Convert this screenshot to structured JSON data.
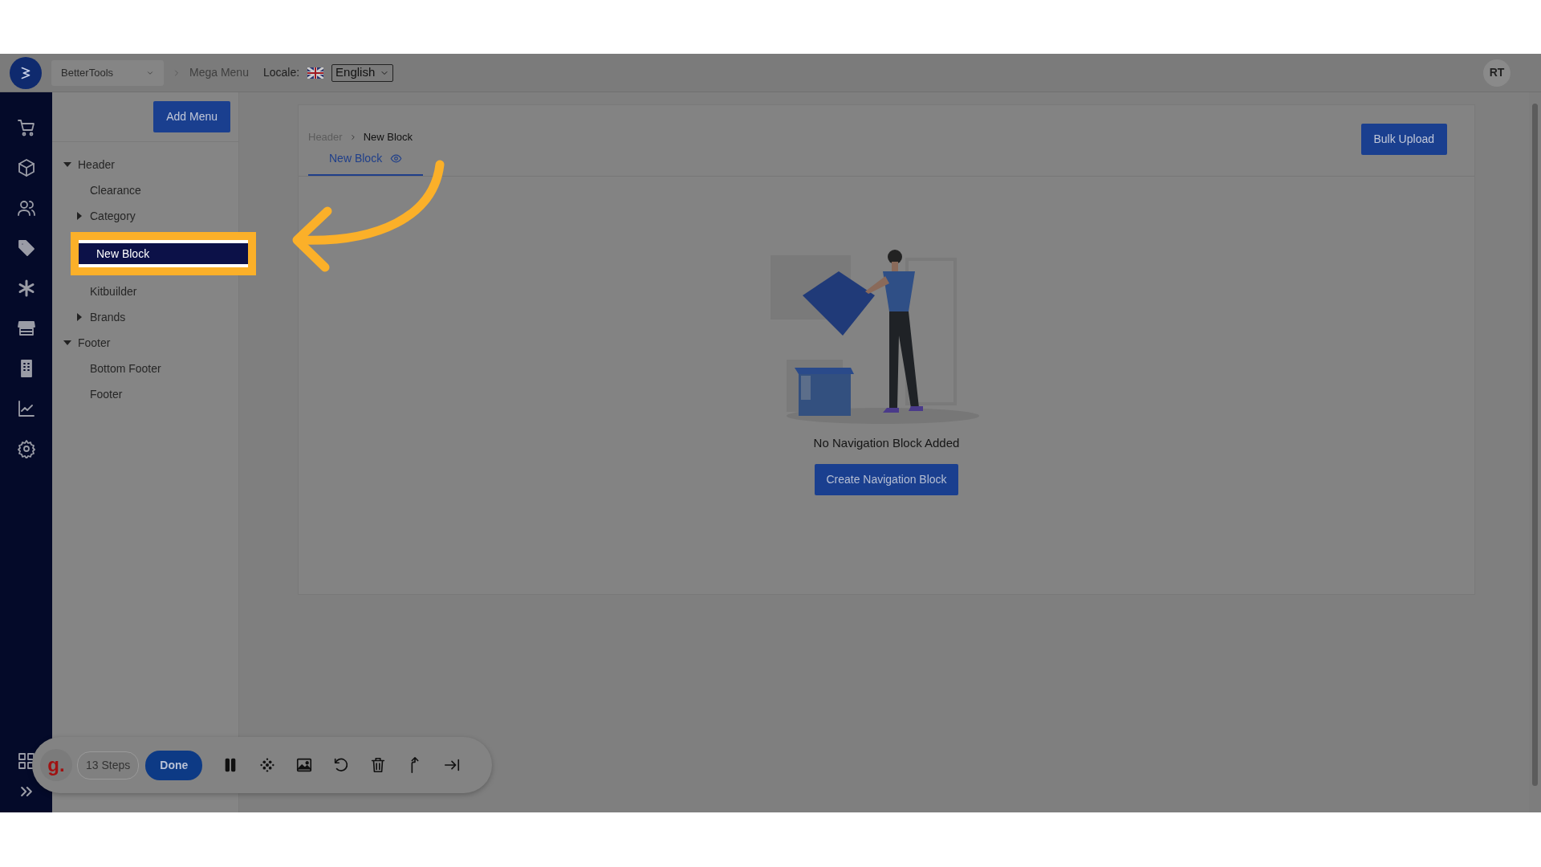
{
  "top_bar": {
    "store_select": "BetterTools",
    "breadcrumb": "Mega Menu",
    "locale_label": "Locale:",
    "locale_value": "English",
    "avatar": "RT"
  },
  "tree": {
    "add_button": "Add Menu",
    "items": [
      {
        "label": "Header",
        "selected": false,
        "expanded": true,
        "children": [
          {
            "label": "Clearance",
            "selected": false
          },
          {
            "label": "Category",
            "selected": false,
            "expanded": false
          },
          {
            "label": "New Block",
            "selected": true
          },
          {
            "label": "Kitbuilder",
            "selected": false
          },
          {
            "label": "Brands",
            "selected": false,
            "expanded": false
          }
        ]
      },
      {
        "label": "Footer",
        "selected": false,
        "expanded": true,
        "children": [
          {
            "label": "Bottom Footer",
            "selected": false
          },
          {
            "label": "Footer",
            "selected": false
          }
        ]
      }
    ]
  },
  "content": {
    "breadcrumb": [
      "Header",
      "New Block"
    ],
    "bulk_button": "Bulk Upload",
    "tabs": [
      {
        "label": "New Block",
        "selected": true
      }
    ],
    "empty_message": "No Navigation Block Added",
    "create_button": "Create Navigation Block"
  },
  "recorder": {
    "logo": "g.",
    "steps": "13 Steps",
    "done_button": "Done"
  }
}
